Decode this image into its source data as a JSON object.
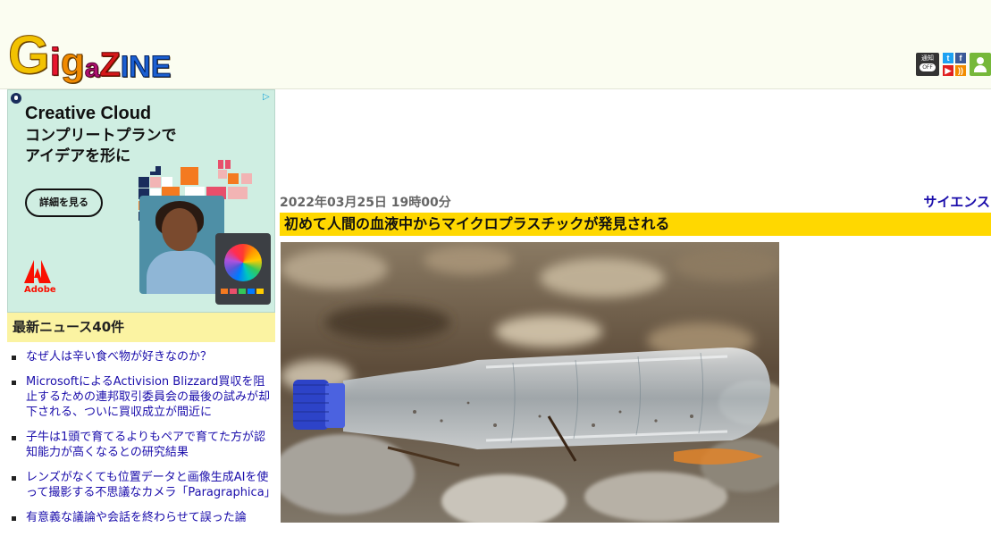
{
  "header": {
    "logo": [
      "G",
      "i",
      "g",
      "a",
      "Z",
      "I",
      "N",
      "E"
    ],
    "notification": {
      "label": "通知",
      "state": "OFF"
    },
    "social": [
      "twitter-icon",
      "facebook-icon",
      "youtube-icon",
      "rss-icon"
    ],
    "user_icon": "user-icon"
  },
  "ad": {
    "title": "Creative Cloud",
    "subtitle": "コンプリートプランで\nアイデアを形に",
    "button": "詳細を見る",
    "brand": "Adobe"
  },
  "sidebar": {
    "heading": "最新ニュース40件",
    "items": [
      "なぜ人は辛い食べ物が好きなのか？",
      "MicrosoftによるActivision Blizzard買収を阻止するための連邦取引委員会の最後の試みが却下される、ついに買収成立が間近に",
      "子牛は1頭で育てるよりもペアで育てた方が認知能力が高くなるとの研究結果",
      "レンズがなくても位置データと画像生成AIを使って撮影する不思議なカメラ「Paragraphica」",
      "有意義な議論や会話を終わらせて誤った論"
    ]
  },
  "article": {
    "date": "2022年03月25日 19時00分",
    "category": "サイエンス",
    "title": "初めて人間の血液中からマイクロプラスチックが発見される"
  },
  "colors": {
    "header_bg": "#fbfdf1",
    "title_bar": "#ffd800",
    "sidebar_head": "#fbf3a2",
    "link": "#1a0dab"
  }
}
